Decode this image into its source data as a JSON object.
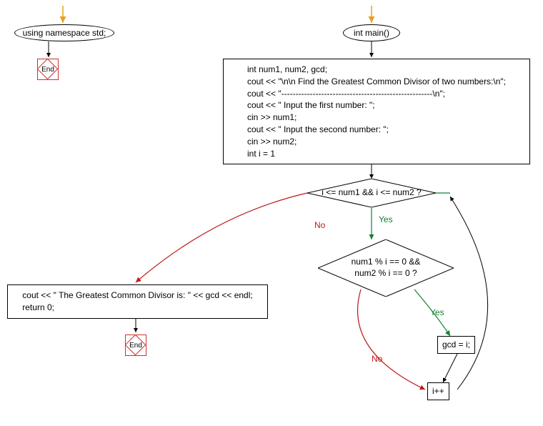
{
  "nodes": {
    "namespace": "using namespace std;",
    "end1": "End",
    "main": "int main()",
    "block1": "int num1, num2, gcd;\ncout << \"\\n\\n Find the Greatest Common Divisor of two numbers:\\n\";\ncout << \"-----------------------------------------------------\\n\";\ncout << \" Input the first number: \";\ncin >> num1;\ncout << \" Input the second number: \";\ncin >> num2;\nint i = 1",
    "cond1": "i <= num1 && i <= num2 ?",
    "cond2": "num1 % i == 0 &&\nnum2 % i == 0 ?",
    "assign": "gcd = i;",
    "inc": "i++",
    "output": "cout << \" The Greatest Common Divisor is: \" << gcd << endl;\nreturn 0;",
    "end2": "End"
  },
  "labels": {
    "yes1": "Yes",
    "no1": "No",
    "yes2": "Yes",
    "no2": "No"
  },
  "colors": {
    "arrow_default": "#000000",
    "arrow_entry": "#e8a020",
    "arrow_yes": "#108030",
    "arrow_no": "#c01818",
    "end_border": "#d03030"
  }
}
